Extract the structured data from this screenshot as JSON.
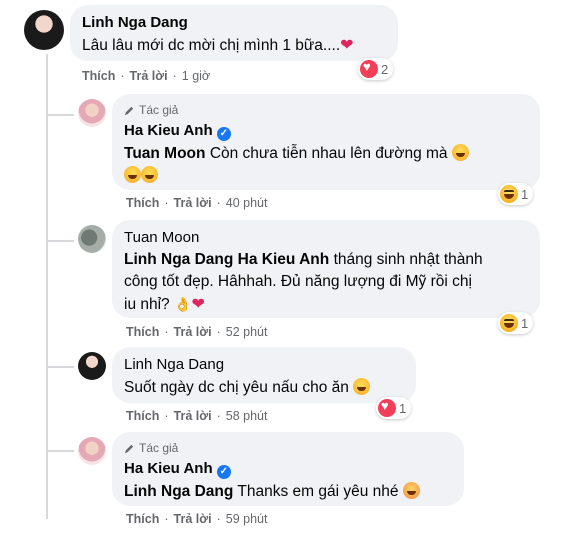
{
  "comments": [
    {
      "name": "Linh Nga Dang",
      "text": "Lâu lâu mới dc mời chị mình 1 bữa....",
      "like": "Thích",
      "reply": "Trả lời",
      "time": "1 giờ",
      "reaction_count": "2",
      "reaction": "heart"
    },
    {
      "author_tag": "Tác giả",
      "name": "Ha Kieu Anh",
      "mention": "Tuan Moon",
      "text": "Còn chưa tiễn nhau lên đường mà",
      "like": "Thích",
      "reply": "Trả lời",
      "time": "40 phút",
      "reaction_count": "1",
      "reaction": "haha"
    },
    {
      "name": "Tuan Moon",
      "mention1": "Linh Nga Dang",
      "mention2": "Ha Kieu Anh",
      "text_line1": "tháng sinh nhật thành",
      "text_line2": "công tốt đẹp. Hâhhah. Đủ năng lượng đi Mỹ rồi chị",
      "text_line3": "iu nhỉ?",
      "like": "Thích",
      "reply": "Trả lời",
      "time": "52 phút",
      "reaction_count": "1",
      "reaction": "haha"
    },
    {
      "name": "Linh Nga Dang",
      "text": "Suốt ngày dc chị yêu nấu cho ăn",
      "like": "Thích",
      "reply": "Trả lời",
      "time": "58 phút",
      "reaction_count": "1",
      "reaction": "heart"
    },
    {
      "author_tag": "Tác giả",
      "name": "Ha Kieu Anh",
      "mention": "Linh Nga Dang",
      "text": "Thanks em gái yêu nhé",
      "like": "Thích",
      "reply": "Trả lời",
      "time": "59 phút"
    }
  ],
  "colors": {
    "bubble": "#f0f2f5",
    "meta": "#65676b",
    "verified": "#1877f2",
    "heart": "#f33e58"
  },
  "icons": [
    "pencil-icon",
    "verified-badge-icon",
    "heart-reaction-icon",
    "haha-reaction-icon"
  ]
}
